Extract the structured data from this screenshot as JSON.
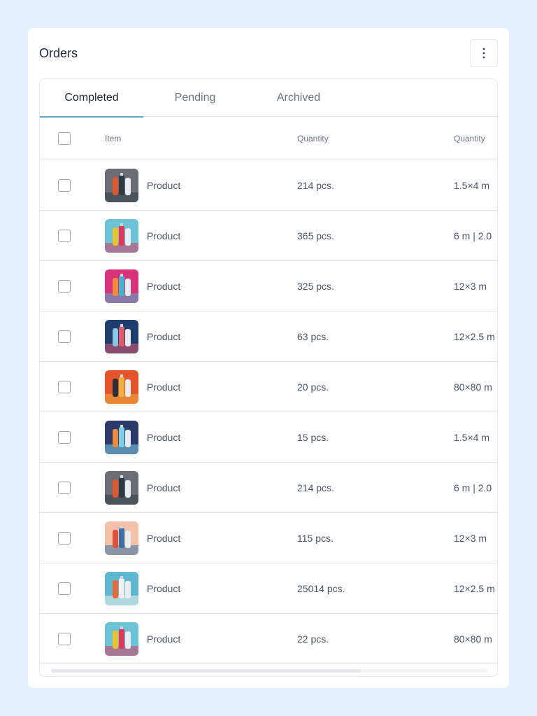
{
  "card": {
    "title": "Orders",
    "more_icon": "vertical-dots-icon"
  },
  "tabs": [
    {
      "label": "Completed",
      "active": true
    },
    {
      "label": "Pending",
      "active": false
    },
    {
      "label": "Archived",
      "active": false
    }
  ],
  "table": {
    "columns": [
      "Item",
      "Quantity",
      "Quantity"
    ],
    "rows": [
      {
        "item": "Product",
        "quantity": "214 pcs.",
        "size": "1.5×4 m",
        "thumb_colors": [
          "#6b6f75",
          "#e0572b",
          "#2f3b44"
        ]
      },
      {
        "item": "Product",
        "quantity": "365 pcs.",
        "size": "6 m | 2.0",
        "thumb_colors": [
          "#6cc4d6",
          "#e8c12b",
          "#d93b5e"
        ]
      },
      {
        "item": "Product",
        "quantity": "325 pcs.",
        "size": "12×3 m",
        "thumb_colors": [
          "#d8337a",
          "#f08a3c",
          "#4bb0c8"
        ]
      },
      {
        "item": "Product",
        "quantity": "63 pcs.",
        "size": "12×2.5 m",
        "thumb_colors": [
          "#1f3c6e",
          "#8ec5e6",
          "#e05a6e"
        ]
      },
      {
        "item": "Product",
        "quantity": "20 pcs.",
        "size": "80×80 m",
        "thumb_colors": [
          "#e2552a",
          "#2a2f38",
          "#f0b040"
        ]
      },
      {
        "item": "Product",
        "quantity": "15 pcs.",
        "size": "1.5×4 m",
        "thumb_colors": [
          "#2a3b6a",
          "#f08a3c",
          "#7fd0e6"
        ]
      },
      {
        "item": "Product",
        "quantity": "214 pcs.",
        "size": "6 m | 2.0",
        "thumb_colors": [
          "#6b6f75",
          "#e0572b",
          "#2f3b44"
        ]
      },
      {
        "item": "Product",
        "quantity": "115 pcs.",
        "size": "12×3 m",
        "thumb_colors": [
          "#f2c1a8",
          "#e04f3a",
          "#3a6fa8"
        ]
      },
      {
        "item": "Product",
        "quantity": "25014 pcs.",
        "size": "12×2.5 m",
        "thumb_colors": [
          "#5fb8cf",
          "#e46a3a",
          "#f0f0f0"
        ]
      },
      {
        "item": "Product",
        "quantity": "22 pcs.",
        "size": "80×80 m",
        "thumb_colors": [
          "#6cc4d6",
          "#e8c12b",
          "#d93b5e"
        ]
      }
    ]
  },
  "scroll": {
    "position": 0.0,
    "visible_fraction": 0.71
  }
}
